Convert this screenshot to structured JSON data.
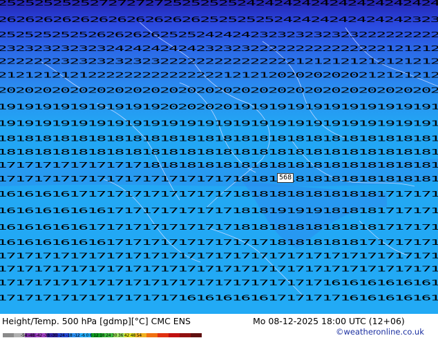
{
  "map": {
    "background_colors": {
      "deep": "#2222b0",
      "mid": "#2b5ce8",
      "light": "#2a8ef0",
      "cyan": "#22aaf5",
      "band": "#2a95f0",
      "land_line": "#c7d7ff"
    },
    "contour_value_rows": [
      "252525252527272727252525252424242424242424242424",
      "262626262626262626262625252525242424242424242323",
      "2525252525262626262525242424232323232323222222222",
      "2323232323232424242424232323222222222222222121212",
      "2222222323232323232222222222222221212121212121212",
      "2121212121222222222222222121212020202020212121212",
      "2020202020202020202020202020202020202020202020202",
      "1919191919191919192020202019191919191919191919191",
      "1919191919191919191919191919191919191919191919191",
      "1818181818181818181818181818181818181818181818181",
      "1818181818181818181818181818181818181818181818181",
      "1717171717171717181818181818181818181818181818181",
      "1717171717171717171717171718181818181818181818181",
      "1616161617171717171717171718181818181818181717171",
      "1616161616161717171717171718181919191818181717171",
      "1616161616171717171717171718181818181818181717171",
      "1616161616161717171717171717171818181818171717171",
      "1717171717171717171717171717171717171717171717171",
      "1717171717171717171717171717171717171717171717171",
      "1717171717171717171717171717171717171616161616161",
      "1717171717171717171716161616161717171716161616161"
    ],
    "marker": "568"
  },
  "footer": {
    "title": "Height/Temp. 500 hPa [gdmp][°C] CMC ENS",
    "datetime": "Mo 08-12-2025 18:00 UTC (12+06)",
    "credit": "©weatheronline.co.uk",
    "colorbar_ticks": "-54 -48 -42 -38 -30 -24 -18 -12 -6  0  6  12  18  24  30  36  42  48  54",
    "colorbar_colors": [
      "#8a8a8a",
      "#b0b0b0",
      "#7a2aa0",
      "#a040c0",
      "#3020a0",
      "#2244d0",
      "#2a8ef0",
      "#22aaf5",
      "#10a020",
      "#40c040",
      "#a0e060",
      "#e0e020",
      "#f0b020",
      "#f07010",
      "#e03010",
      "#c01010",
      "#901010",
      "#601010"
    ]
  }
}
